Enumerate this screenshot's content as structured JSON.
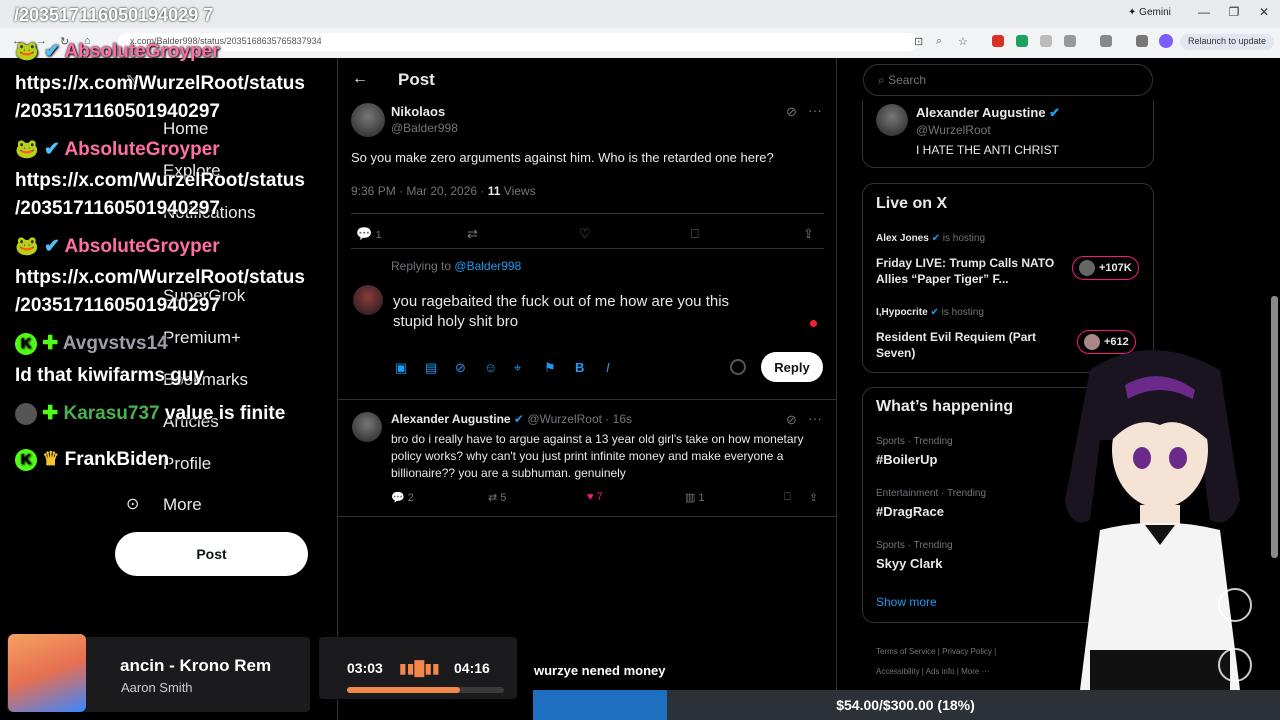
{
  "browser": {
    "tab_title": "/203517116050194029 7",
    "gemini_label": "Gemini",
    "url": "x.com/Balder998/status/2035168635765837934",
    "relaunch_label": "Relaunch to update"
  },
  "chat": [
    {
      "text": "/2035171160501940297"
    },
    {
      "name": "AbsoluteGroyper"
    },
    {
      "text": "https://x.com/WurzelRoot/status"
    },
    {
      "text": "/2035171160501940297"
    },
    {
      "name": "AbsoluteGroyper"
    },
    {
      "text": "https://x.com/WurzelRoot/status"
    },
    {
      "text": "/2035171160501940297"
    },
    {
      "name": "AbsoluteGroyper"
    },
    {
      "text": "https://x.com/WurzelRoot/status"
    },
    {
      "text": "/2035171160501940297"
    },
    {
      "name": "Avgvstvs14"
    },
    {
      "text": "Id that kiwifarms guy"
    },
    {
      "name": "Karasu737",
      "message": "value is finite"
    },
    {
      "name": "FrankBiden"
    }
  ],
  "nav": {
    "home": "Home",
    "explore": "Explore",
    "notifications": "Notifications",
    "supergrok": "SuperGrok",
    "premium": "Premium+",
    "bookmarks": "Bookmarks",
    "articles": "Articles",
    "profile": "Profile",
    "more": "More",
    "post": "Post"
  },
  "post": {
    "header": "Post",
    "author": "Nikolaos",
    "handle": "@Balder998",
    "text": "So you make zero arguments against him. Who is the retarded one here?",
    "time": "9:36 PM · Mar 20, 2026 ·",
    "views_count": "11",
    "views_label": "Views",
    "reply_count": "1"
  },
  "composer": {
    "replying_prefix": "Replying to",
    "replying_handle": "@Balder998",
    "text_line1": "you ragebaited the fuck out of me how are you this",
    "text_line2": "stupid holy shit bro",
    "reply_label": "Reply"
  },
  "reply": {
    "author": "Alexander Augustine",
    "handle": "@WurzelRoot · 16s",
    "text": "bro do i really have to argue against a 13 year old girl's take on how monetary policy works? why can't you just print infinite money and make everyone a billionaire?? you are a subhuman. genuinely",
    "replies": "2",
    "reposts": "5",
    "likes": "7",
    "views": "1"
  },
  "right": {
    "search_placeholder": "Search",
    "pinned_name": "Alexander Augustine",
    "pinned_handle": "@WurzelRoot",
    "pinned_bio": "I HATE THE ANTI CHRIST",
    "live_title": "Live on X",
    "live": [
      {
        "host": "Alex Jones",
        "hosting": "is hosting",
        "title": "Friday LIVE: Trump Calls NATO Allies “Paper Tiger” F...",
        "count": "+107K"
      },
      {
        "host": "I,Hypocrite",
        "hosting": "is hosting",
        "title": "Resident Evil Requiem (Part Seven)",
        "count": "+612"
      }
    ],
    "happening_title": "What’s happening",
    "trends": [
      {
        "cat": "Sports · Trending",
        "name": "#BoilerUp"
      },
      {
        "cat": "Entertainment · Trending",
        "name": "#DragRace"
      },
      {
        "cat": "Sports · Trending",
        "name": "Skyy Clark"
      }
    ],
    "show_more": "Show more",
    "footer_line1": "Terms of Service | Privacy Policy |",
    "footer_line2": "Accessibility | Ads info | More ···"
  },
  "overlay": {
    "song": "ancin - Krono Rem",
    "artist": "Aaron Smith",
    "elapsed": "03:03",
    "total": "04:16",
    "progress_fraction": 0.72,
    "ticker": "wurzye nened money",
    "goal": "$54.00/$300.00 (18%)",
    "goal_fraction": 0.18
  },
  "colors": {
    "x_blue": "#1d9bf0",
    "like_pink": "#f91880",
    "goal_blue": "#1e6fbf"
  }
}
